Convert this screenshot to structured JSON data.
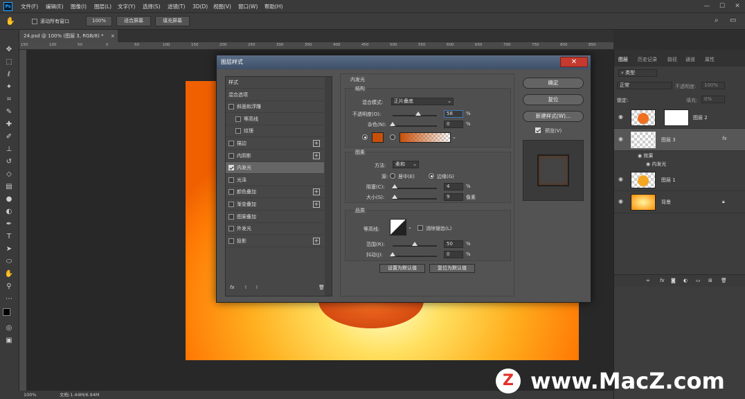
{
  "menubar": {
    "app_icon": "Ps",
    "items": [
      "文件(F)",
      "编辑(E)",
      "图像(I)",
      "图层(L)",
      "文字(Y)",
      "选择(S)",
      "滤镜(T)",
      "3D(D)",
      "视图(V)",
      "窗口(W)",
      "帮助(H)"
    ],
    "window_controls": [
      "—",
      "☐",
      "✕"
    ]
  },
  "options_bar": {
    "scroll_all_label": "滚动所有窗口",
    "zoom_value": "100%",
    "fit_screen": "适合屏幕",
    "fill_screen": "填充屏幕"
  },
  "document": {
    "tab_label": "24.psd @ 100% (图层 3, RGB/8) *",
    "tab_close": "×",
    "ruler_numbers": [
      "150",
      "100",
      "50",
      "0",
      "50",
      "100",
      "150",
      "200",
      "250",
      "300",
      "350",
      "400",
      "450",
      "500",
      "550",
      "600",
      "650",
      "700",
      "750",
      "800",
      "850"
    ]
  },
  "status_bar": {
    "zoom": "100%",
    "doc_info": "文档:1.44M/6.94M"
  },
  "dialog": {
    "title": "图层样式",
    "close": "✕",
    "styles": [
      {
        "label": "样式",
        "checkbox": false,
        "checked": false,
        "plus": false,
        "indent": false
      },
      {
        "label": "混合选项",
        "checkbox": false,
        "checked": false,
        "plus": false,
        "indent": false
      },
      {
        "label": "斜面和浮雕",
        "checkbox": true,
        "checked": false,
        "plus": false,
        "indent": false
      },
      {
        "label": "等高线",
        "checkbox": true,
        "checked": false,
        "plus": false,
        "indent": true
      },
      {
        "label": "纹理",
        "checkbox": true,
        "checked": false,
        "plus": false,
        "indent": true
      },
      {
        "label": "描边",
        "checkbox": true,
        "checked": false,
        "plus": true,
        "indent": false
      },
      {
        "label": "内阴影",
        "checkbox": true,
        "checked": false,
        "plus": true,
        "indent": false
      },
      {
        "label": "内发光",
        "checkbox": true,
        "checked": true,
        "plus": false,
        "indent": false,
        "selected": true
      },
      {
        "label": "光泽",
        "checkbox": true,
        "checked": false,
        "plus": false,
        "indent": false
      },
      {
        "label": "颜色叠加",
        "checkbox": true,
        "checked": false,
        "plus": true,
        "indent": false
      },
      {
        "label": "渐变叠加",
        "checkbox": true,
        "checked": false,
        "plus": true,
        "indent": false
      },
      {
        "label": "图案叠加",
        "checkbox": true,
        "checked": false,
        "plus": false,
        "indent": false
      },
      {
        "label": "外发光",
        "checkbox": true,
        "checked": false,
        "plus": false,
        "indent": false
      },
      {
        "label": "投影",
        "checkbox": true,
        "checked": false,
        "plus": true,
        "indent": false
      }
    ],
    "footer_fx": "fx",
    "inner_glow": {
      "title": "内发光",
      "structure_title": "结构",
      "blend_mode_label": "混合模式:",
      "blend_mode_value": "正片叠底",
      "opacity_label": "不透明度(O):",
      "opacity_value": "58",
      "opacity_unit": "%",
      "opacity_level": 0.58,
      "noise_label": "杂色(N):",
      "noise_value": "0",
      "noise_unit": "%",
      "noise_level": 0,
      "glow_color": "#c8500a",
      "elements_title": "图素",
      "method_label": "方法:",
      "method_value": "柔和",
      "source_label": "源:",
      "source_center": "居中(E)",
      "source_edge": "边缘(G)",
      "choke_label": "阻塞(C):",
      "choke_value": "4",
      "choke_unit": "%",
      "choke_level": 0.04,
      "size_label": "大小(S):",
      "size_value": "9",
      "size_unit": "像素",
      "size_level": 0.04,
      "quality_title": "品质",
      "contour_label": "等高线:",
      "antialias_label": "消除锯齿(L)",
      "range_label": "范围(R):",
      "range_value": "50",
      "range_unit": "%",
      "range_level": 0.5,
      "jitter_label": "抖动(J):",
      "jitter_value": "0",
      "jitter_unit": "%",
      "jitter_level": 0,
      "make_default": "设置为默认值",
      "reset_default": "复位为默认值"
    },
    "buttons": {
      "ok": "确定",
      "reset": "复位",
      "new_style": "新建样式(W)...",
      "preview_label": "预览(V)"
    }
  },
  "layers_panel": {
    "tabs": [
      "图层",
      "历史记录",
      "路径",
      "通道",
      "属性"
    ],
    "filter_placeholder": "类型",
    "blend_mode": "正常",
    "opacity_label": "不透明度:",
    "opacity_value": "100%",
    "lock_label": "锁定:",
    "fill_label": "填充:",
    "fill_value": "0%",
    "layers": [
      {
        "name": "图层 2"
      },
      {
        "name": "图层 3",
        "fx": "fx"
      },
      {
        "name": "效果"
      },
      {
        "name": "内发光"
      },
      {
        "name": "图层 1"
      },
      {
        "name": "背景"
      }
    ]
  },
  "watermark": {
    "logo_letter": "Z",
    "text": "www.MacZ.com"
  }
}
